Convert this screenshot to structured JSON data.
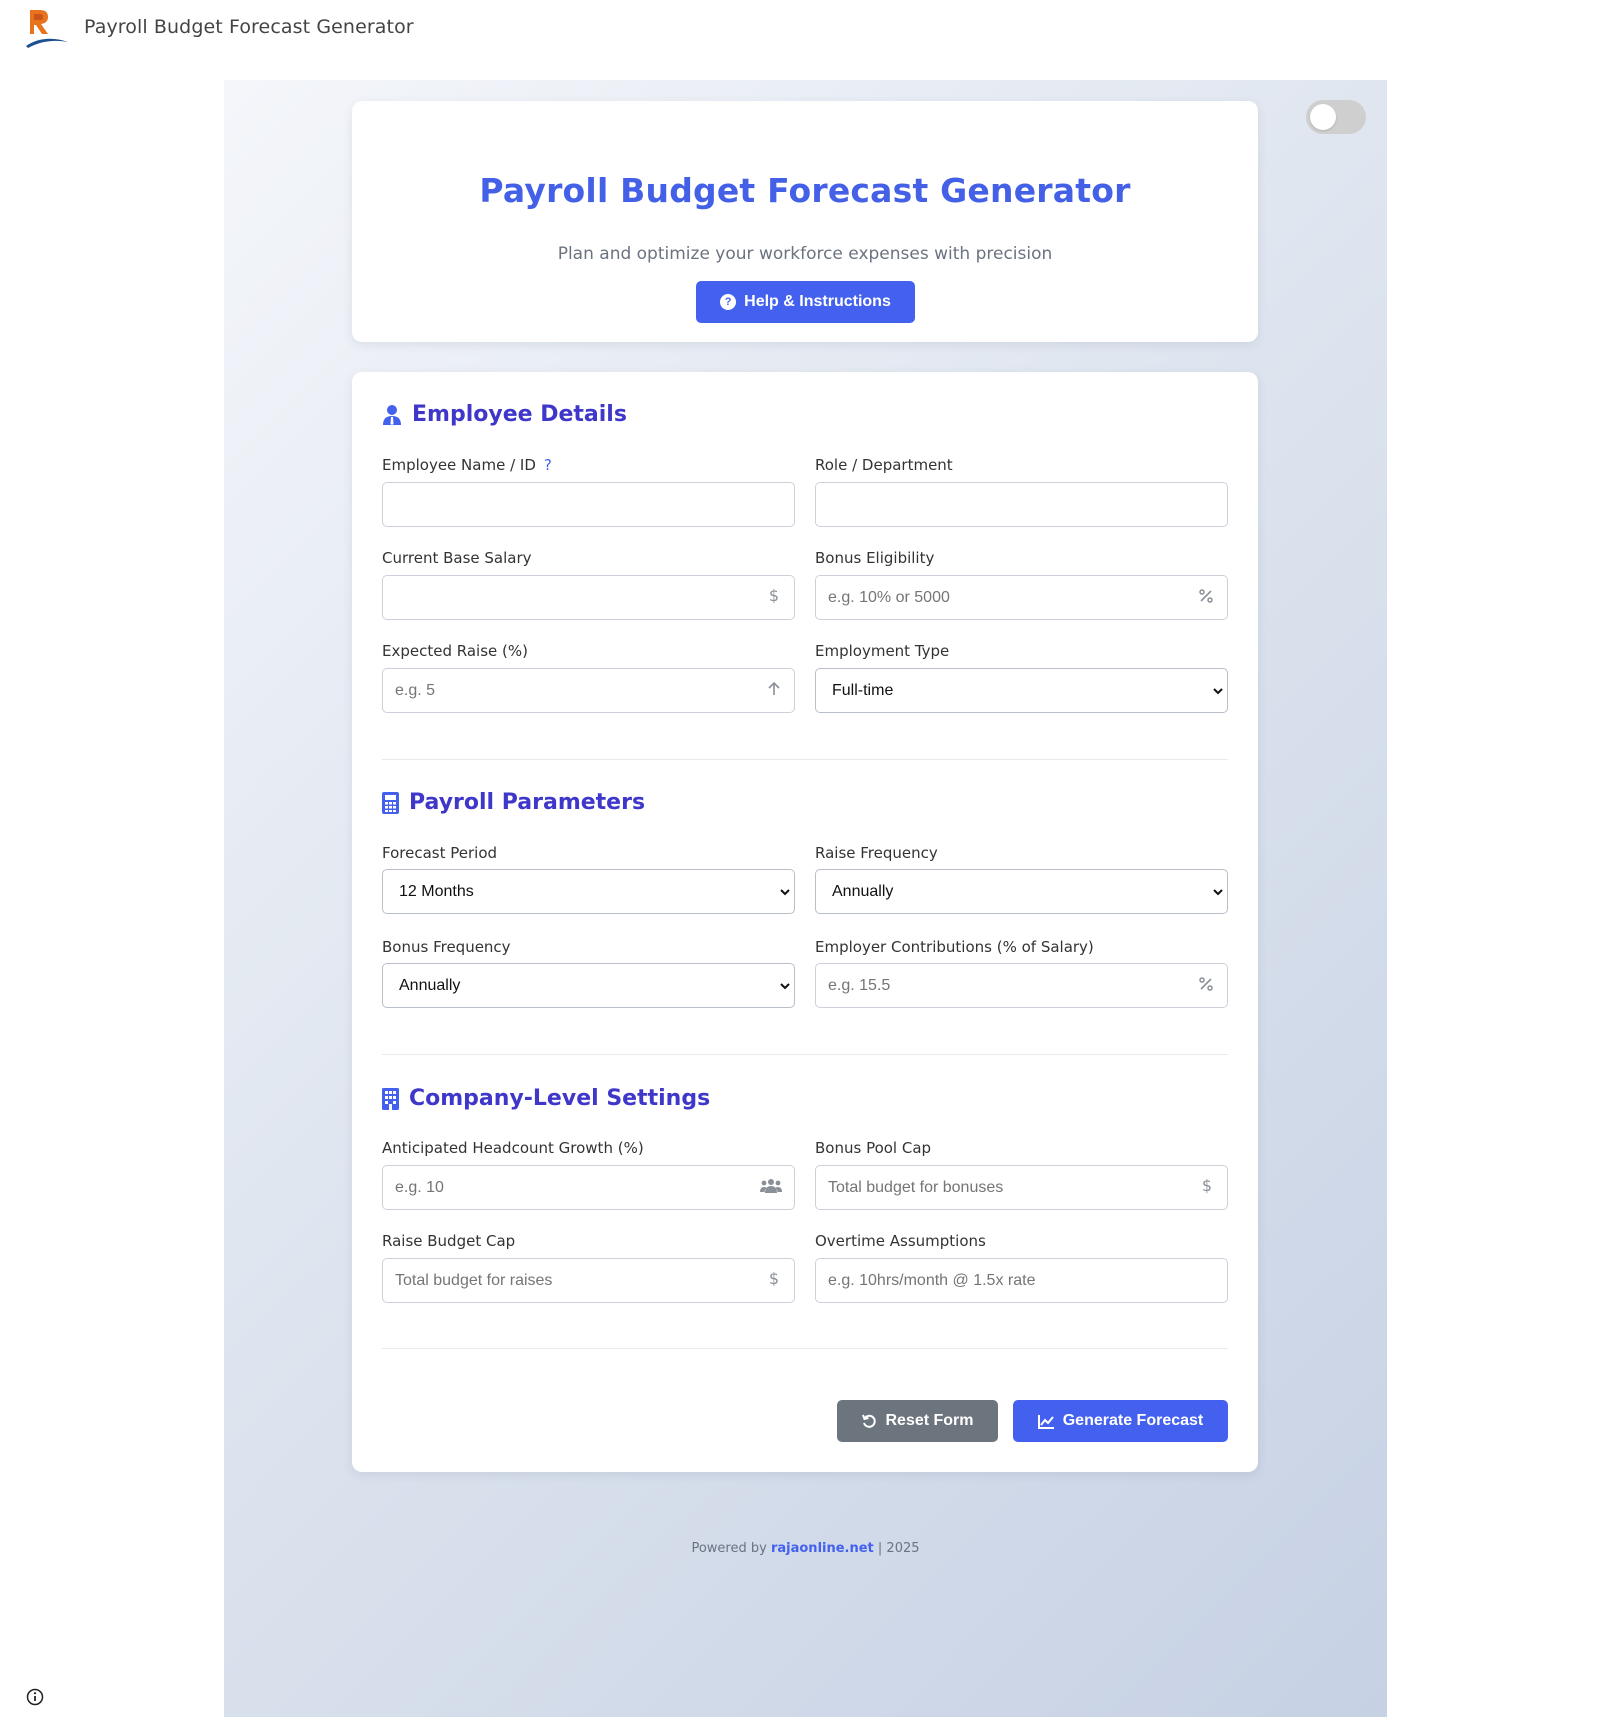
{
  "app": {
    "title": "Payroll Budget Forecast Generator"
  },
  "header": {
    "title": "Payroll Budget Forecast Generator",
    "subtitle": "Plan and optimize your workforce expenses with precision",
    "help_label": "Help & Instructions"
  },
  "theme": {
    "accent": "#4361ee",
    "section_title_color": "#3f37c9",
    "toggle_on": false
  },
  "employee": {
    "title": "Employee Details",
    "name": {
      "label": "Employee Name / ID",
      "help": "?",
      "value": "",
      "placeholder": ""
    },
    "role": {
      "label": "Role / Department",
      "value": "",
      "placeholder": ""
    },
    "salary": {
      "label": "Current Base Salary",
      "value": "",
      "placeholder": "",
      "icon": "dollar-icon"
    },
    "bonus": {
      "label": "Bonus Eligibility",
      "value": "",
      "placeholder": "e.g. 10% or 5000",
      "icon": "percent-icon"
    },
    "raise": {
      "label": "Expected Raise (%)",
      "value": "",
      "placeholder": "e.g. 5",
      "icon": "arrow-up-icon"
    },
    "type": {
      "label": "Employment Type",
      "selected": "Full-time"
    }
  },
  "payroll": {
    "title": "Payroll Parameters",
    "period": {
      "label": "Forecast Period",
      "selected": "12 Months"
    },
    "raise_frequency": {
      "label": "Raise Frequency",
      "selected": "Annually"
    },
    "bonus_frequency": {
      "label": "Bonus Frequency",
      "selected": "Annually"
    },
    "contributions": {
      "label": "Employer Contributions (% of Salary)",
      "value": "",
      "placeholder": "e.g. 15.5",
      "icon": "percent-icon"
    }
  },
  "company": {
    "title": "Company-Level Settings",
    "headcount": {
      "label": "Anticipated Headcount Growth (%)",
      "value": "",
      "placeholder": "e.g. 10",
      "icon": "users-icon"
    },
    "bonus_pool": {
      "label": "Bonus Pool Cap",
      "value": "",
      "placeholder": "Total budget for bonuses",
      "icon": "dollar-icon"
    },
    "raise_budget": {
      "label": "Raise Budget Cap",
      "value": "",
      "placeholder": "Total budget for raises",
      "icon": "dollar-icon"
    },
    "overtime": {
      "label": "Overtime Assumptions",
      "value": "",
      "placeholder": "e.g. 10hrs/month @ 1.5x rate"
    }
  },
  "actions": {
    "reset_label": "Reset Form",
    "generate_label": "Generate Forecast"
  },
  "footer": {
    "prefix": "Powered by",
    "link_text": "rajaonline.net",
    "suffix": "| 2025"
  }
}
